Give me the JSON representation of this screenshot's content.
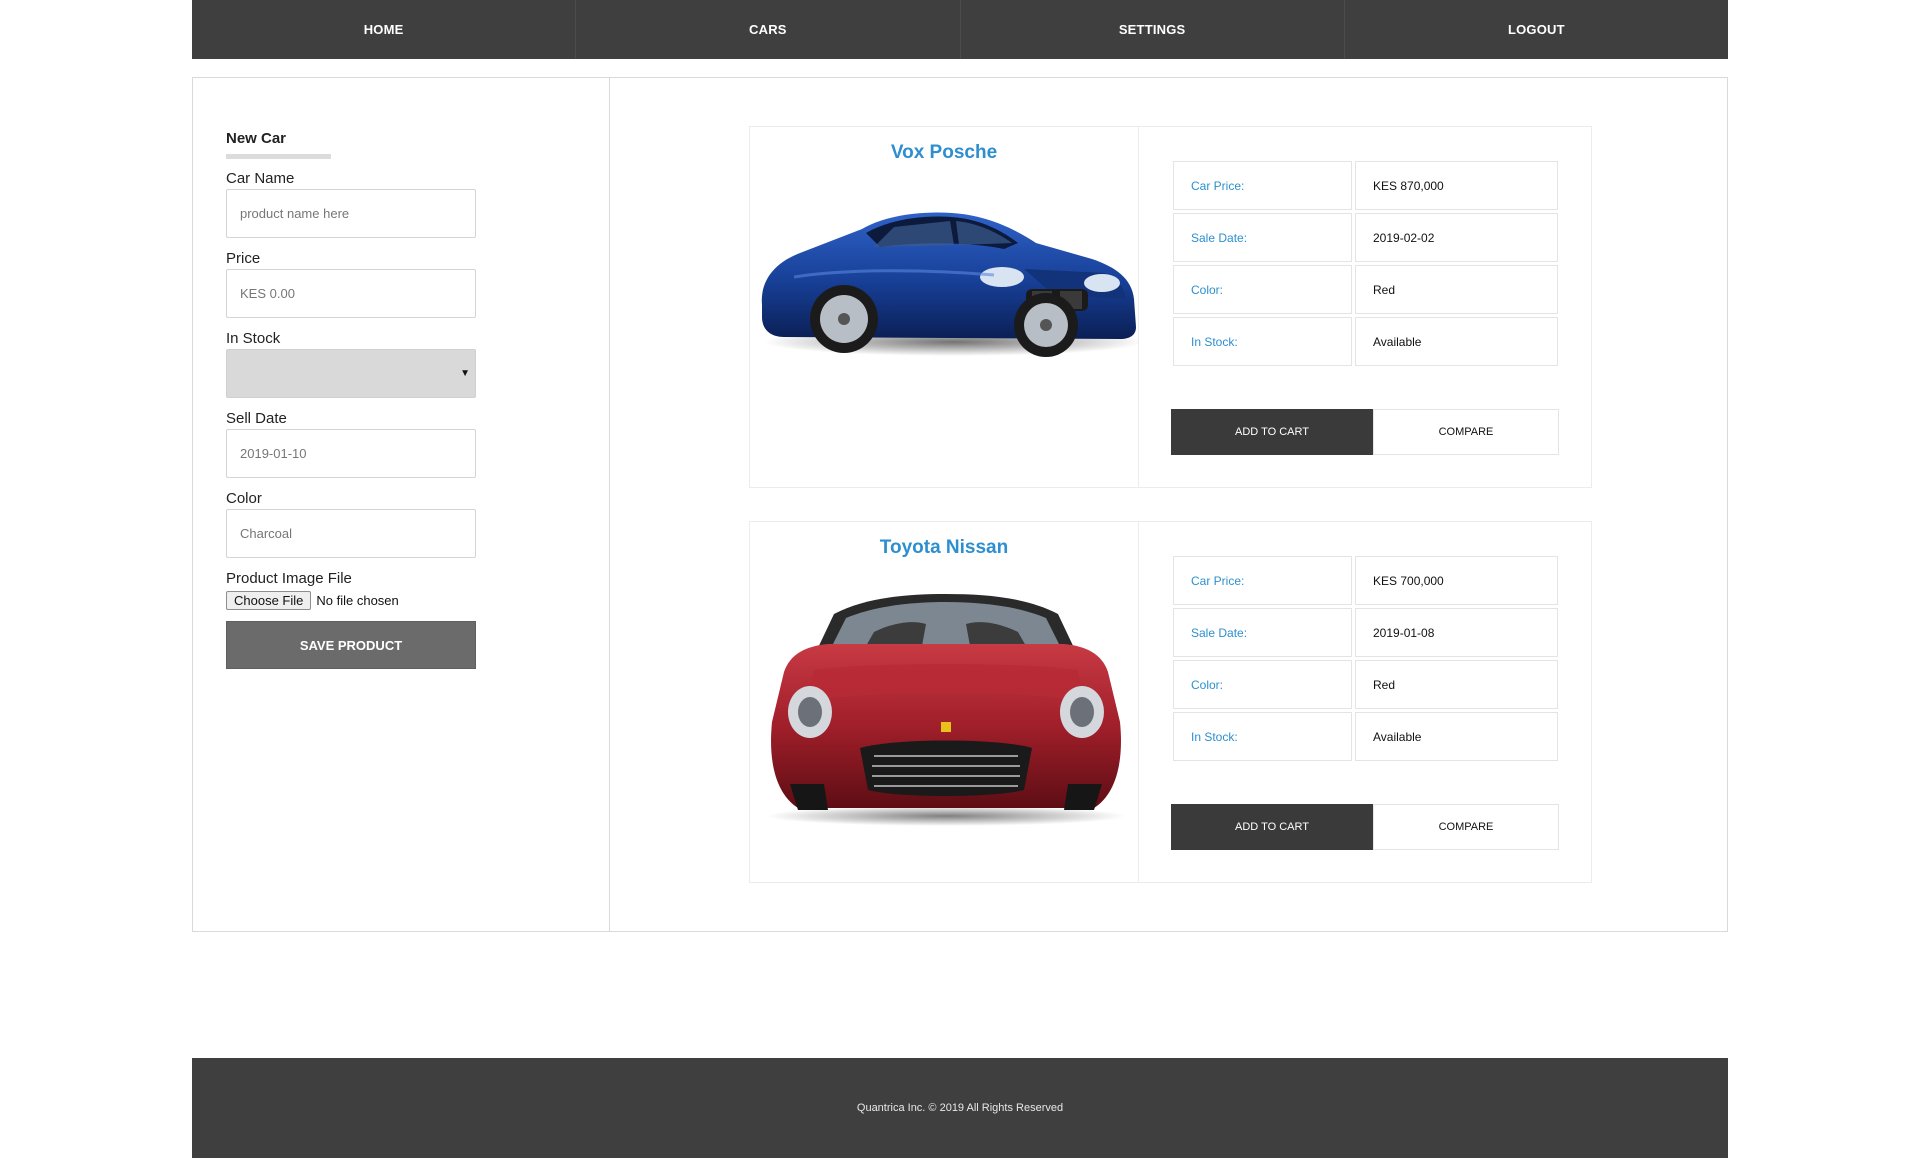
{
  "nav": {
    "items": [
      {
        "label": "HOME"
      },
      {
        "label": "CARS"
      },
      {
        "label": "SETTINGS"
      },
      {
        "label": "LOGOUT"
      }
    ]
  },
  "form": {
    "title": "New Car",
    "fields": {
      "car_name": {
        "label": "Car Name",
        "placeholder": "product name here",
        "value": ""
      },
      "price": {
        "label": "Price",
        "placeholder": "KES 0.00",
        "value": ""
      },
      "in_stock": {
        "label": "In Stock",
        "value": ""
      },
      "sell_date": {
        "label": "Sell Date",
        "placeholder": "2019-01-10",
        "value": ""
      },
      "color": {
        "label": "Color",
        "placeholder": "Charcoal",
        "value": ""
      },
      "image_file": {
        "label": "Product Image File",
        "button_label": "Choose File",
        "status": "No file chosen"
      }
    },
    "save_label": "SAVE PRODUCT"
  },
  "products": [
    {
      "name": "Vox Posche",
      "image_icon": "blue-coupe-car-image",
      "specs": [
        {
          "label": "Car Price:",
          "value": "KES 870,000"
        },
        {
          "label": "Sale Date:",
          "value": "2019-02-02"
        },
        {
          "label": "Color:",
          "value": "Red"
        },
        {
          "label": "In Stock:",
          "value": "Available"
        }
      ],
      "add_to_cart_label": "ADD TO CART",
      "compare_label": "COMPARE"
    },
    {
      "name": "Toyota Nissan",
      "image_icon": "red-convertible-car-image",
      "specs": [
        {
          "label": "Car Price:",
          "value": "KES 700,000"
        },
        {
          "label": "Sale Date:",
          "value": "2019-01-08"
        },
        {
          "label": "Color:",
          "value": "Red"
        },
        {
          "label": "In Stock:",
          "value": "Available"
        }
      ],
      "add_to_cart_label": "ADD TO CART",
      "compare_label": "COMPARE"
    }
  ],
  "footer": {
    "text": "Quantrica Inc. © 2019 All Rights Reserved"
  },
  "colors": {
    "nav_bg": "#3f3f3f",
    "accent_blue": "#2d8fcf",
    "save_button": "#6b6b6b",
    "cart_button": "#3a3a3a"
  }
}
